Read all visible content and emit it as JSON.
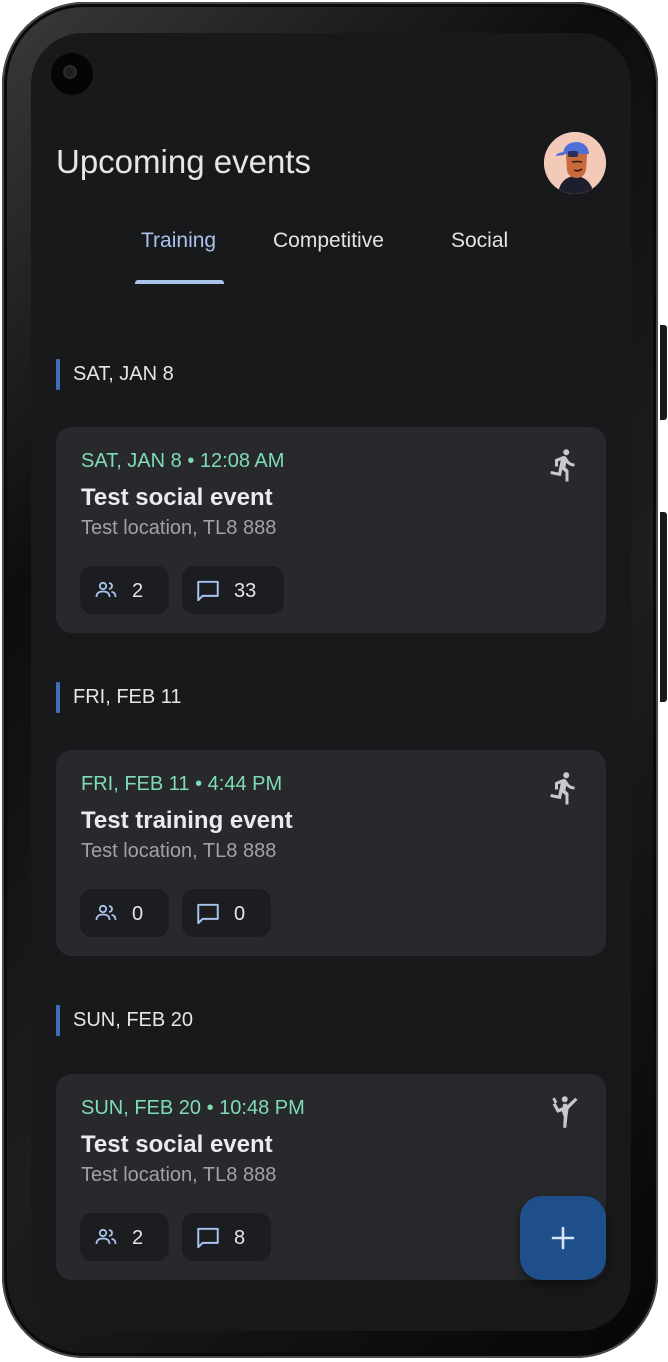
{
  "header": {
    "title": "Upcoming events"
  },
  "tabs": [
    {
      "label": "Training",
      "active": true
    },
    {
      "label": "Competitive",
      "active": false
    },
    {
      "label": "Social",
      "active": false
    }
  ],
  "days": [
    {
      "label": "SAT, JAN 8",
      "events": [
        {
          "when": "SAT, JAN 8 • 12:08 AM",
          "name": "Test social event",
          "location": "Test location, TL8 888",
          "attendees": "2",
          "comments": "33",
          "type_icon": "running-icon"
        }
      ]
    },
    {
      "label": "FRI, FEB 11",
      "events": [
        {
          "when": "FRI, FEB 11 • 4:44 PM",
          "name": "Test training event",
          "location": "Test location, TL8 888",
          "attendees": "0",
          "comments": "0",
          "type_icon": "running-icon"
        }
      ]
    },
    {
      "label": "SUN, FEB 20",
      "events": [
        {
          "when": "SUN, FEB 20 • 10:48 PM",
          "name": "Test social event",
          "location": "Test location, TL8 888",
          "attendees": "2",
          "comments": "8",
          "type_icon": "martial-arts-icon"
        }
      ]
    }
  ],
  "fab": {
    "icon": "plus-icon"
  },
  "colors": {
    "background": "#18191b",
    "card": "#27292c",
    "accent_green": "#7fdcb4",
    "accent_blue": "#a9c3ec",
    "day_bar": "#3f6fb6",
    "fab": "#1e4f8a"
  }
}
